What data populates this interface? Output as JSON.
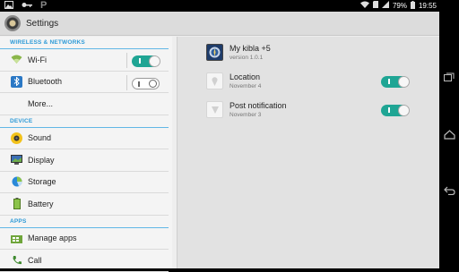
{
  "status_bar": {
    "left_icons": [
      "image-icon",
      "key-icon",
      "p-icon"
    ],
    "p_label": "P",
    "battery_percent": "79%",
    "time": "19:55"
  },
  "action_bar": {
    "title": "Settings"
  },
  "sections": {
    "wireless": "WIRELESS & NETWORKS",
    "device": "DEVICE",
    "apps": "APPS"
  },
  "wireless_items": [
    {
      "label": "Wi-Fi",
      "toggle": "on",
      "toggle_text": "I"
    },
    {
      "label": "Bluetooth",
      "toggle": "off",
      "toggle_text": "O"
    },
    {
      "label": "More..."
    }
  ],
  "device_items": [
    {
      "label": "Sound"
    },
    {
      "label": "Display"
    },
    {
      "label": "Storage"
    },
    {
      "label": "Battery"
    }
  ],
  "apps_items": [
    {
      "label": "Manage apps"
    },
    {
      "label": "Call"
    }
  ],
  "detail": {
    "app": {
      "title": "My kibla +5",
      "subtitle": "version 1.0.1"
    },
    "items": [
      {
        "title": "Location",
        "subtitle": "November 4",
        "toggle": "on",
        "toggle_text": "I"
      },
      {
        "title": "Post notification",
        "subtitle": "November 3",
        "toggle": "on",
        "toggle_text": "I"
      }
    ]
  },
  "colors": {
    "accent": "#2d9ad7",
    "toggle_on": "#1fa594"
  }
}
